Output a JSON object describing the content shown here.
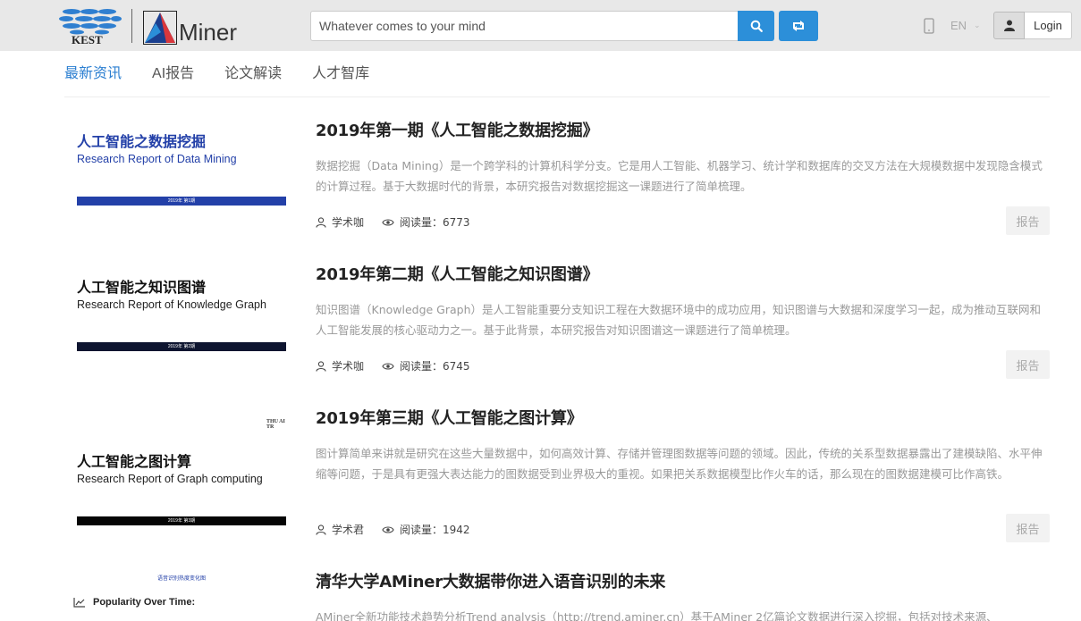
{
  "header": {
    "search_placeholder": "Whatever comes to your mind",
    "lang": "EN",
    "login_label": "Login",
    "brand_name": "Miner",
    "kest_text": "KEST"
  },
  "tabs": [
    {
      "label": "最新资讯",
      "active": true
    },
    {
      "label": "AI报告",
      "active": false
    },
    {
      "label": "论文解读",
      "active": false
    },
    {
      "label": "人才智库",
      "active": false
    }
  ],
  "articles": [
    {
      "thumb_cn": "人工智能之数据挖掘",
      "thumb_en": "Research Report of Data Mining",
      "thumb_bar": "2019年 第1期",
      "title": "2019年第一期《人工智能之数据挖掘》",
      "desc": "数据挖掘（Data Mining）是一个跨学科的计算机科学分支。它是用人工智能、机器学习、统计学和数据库的交叉方法在大规模数据中发现隐含模式的计算过程。基于大数据时代的背景，本研究报告对数据挖掘这一课题进行了简单梳理。",
      "author": "学术咖",
      "reads": "阅读量：6773",
      "tag": "报告"
    },
    {
      "thumb_cn": "人工智能之知识图谱",
      "thumb_en": "Research Report of Knowledge Graph",
      "thumb_bar": "2019年 第2期",
      "title": "2019年第二期《人工智能之知识图谱》",
      "desc": "知识图谱（Knowledge Graph）是人工智能重要分支知识工程在大数据环境中的成功应用，知识图谱与大数据和深度学习一起，成为推动互联网和人工智能发展的核心驱动力之一。基于此背景，本研究报告对知识图谱这一课题进行了简单梳理。",
      "author": "学术咖",
      "reads": "阅读量：6745",
      "tag": "报告"
    },
    {
      "thumb_top": "THU AI TR",
      "thumb_cn": "人工智能之图计算",
      "thumb_en": "Research Report of Graph computing",
      "thumb_bar": "2019年 第3期",
      "title": "2019年第三期《人工智能之图计算》",
      "desc": "图计算简单来讲就是研究在这些大量数据中，如何高效计算、存储并管理图数据等问题的领域。因此，传统的关系型数据暴露出了建模缺陷、水平伸缩等问题，于是具有更强大表达能力的图数据受到业界极大的重视。如果把关系数据模型比作火车的话，那么现在的图数据建模可比作高铁。",
      "author": "学术君",
      "reads": "阅读量：1942",
      "tag": "报告"
    },
    {
      "thumb_small": "语音识别热度变化图",
      "thumb_pop": "Popularity Over Time:",
      "title": "清华大学AMiner大数据带你进入语音识别的未来",
      "desc": "AMiner全新功能技术趋势分析Trend analysis（http://trend.aminer.cn）基于AMiner 2亿篇论文数据进行深入挖掘，包括对技术来源、"
    }
  ],
  "colors": {
    "accent": "#2c8fd9",
    "tab_active": "#2c7fd1",
    "header_bg": "#e8e8e8"
  }
}
